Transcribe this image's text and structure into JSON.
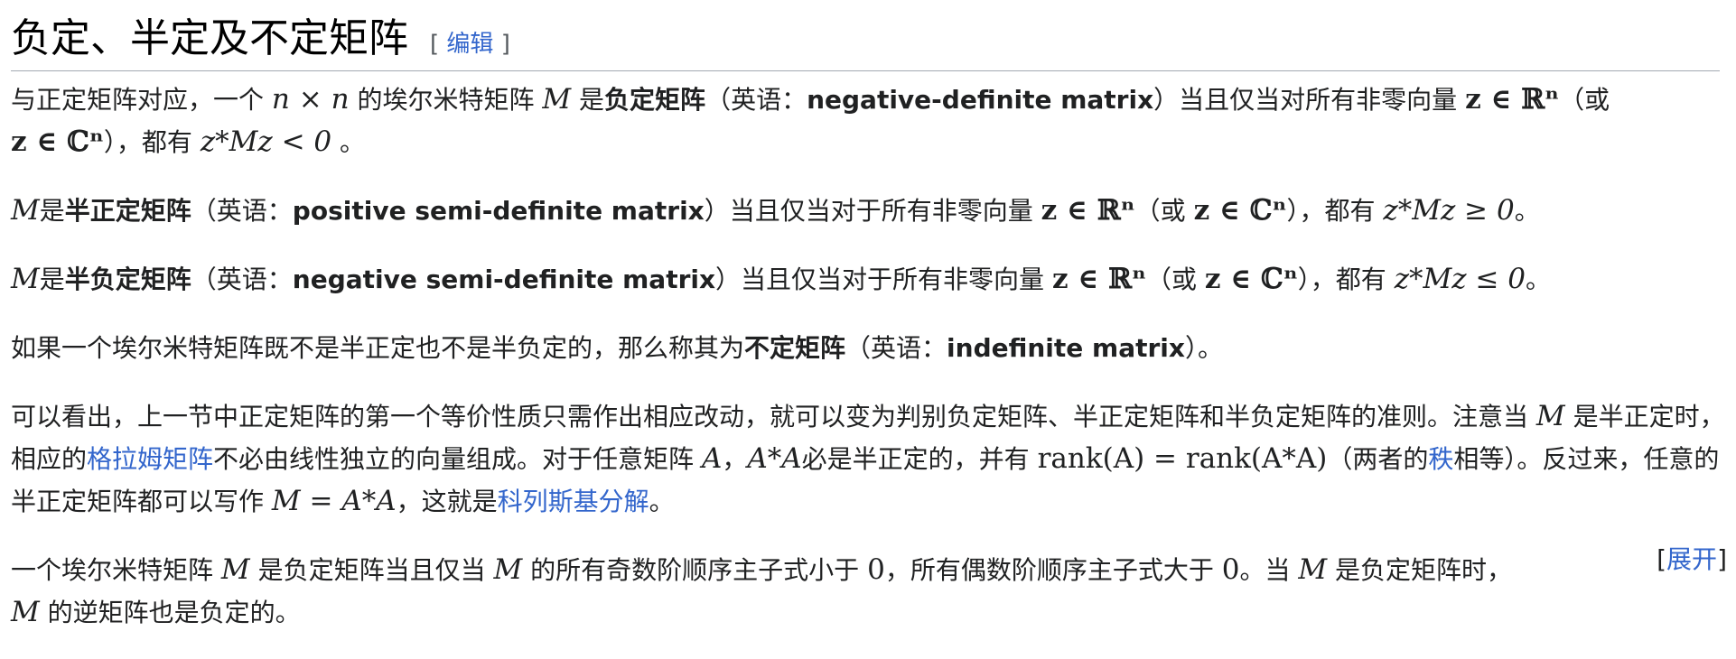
{
  "heading": {
    "title": "负定、半定及不定矩阵",
    "edit_open": "[",
    "edit_label": "编辑",
    "edit_close": "]"
  },
  "p1": {
    "t1": "与正定矩阵对应，一个",
    "m_nxn": "n × n",
    "t2": "的埃尔米特矩阵",
    "m_M": "M",
    "t3": "是",
    "b1": "负定矩阵",
    "t4": "（英语：",
    "b2": "negative-definite matrix",
    "t5": "）当且仅当对所有非零向量",
    "m_zR": "z ∈ ℝⁿ",
    "t6": "（或",
    "m_zC": "z ∈ ℂⁿ",
    "t7": "），都有",
    "m_cond": "z*Mz < 0",
    "t8": "。"
  },
  "p2": {
    "m_M": "M",
    "t1": "是",
    "b1": "半正定矩阵",
    "t2": "（英语：",
    "b2": "positive semi-definite matrix",
    "t3": "）当且仅当对于所有非零向量",
    "m_zR": "z ∈ ℝⁿ",
    "t4": "（或",
    "m_zC": "z ∈ ℂⁿ",
    "t5": "），都有",
    "m_cond": "z*Mz ≥ 0",
    "t6": "。"
  },
  "p3": {
    "m_M": "M",
    "t1": "是",
    "b1": "半负定矩阵",
    "t2": "（英语：",
    "b2": "negative semi-definite matrix",
    "t3": "）当且仅当对于所有非零向量",
    "m_zR": "z ∈ ℝⁿ",
    "t4": "（或",
    "m_zC": "z ∈ ℂⁿ",
    "t5": "），都有",
    "m_cond": "z*Mz ≤ 0",
    "t6": "。"
  },
  "p4": {
    "t1": "如果一个埃尔米特矩阵既不是半正定也不是半负定的，那么称其为",
    "b1": "不定矩阵",
    "t2": "（英语：",
    "b2": "indefinite matrix",
    "t3": "）。"
  },
  "p5": {
    "t1": "可以看出，上一节中正定矩阵的第一个等价性质只需作出相应改动，就可以变为判别负定矩阵、半正定矩阵和半负定矩阵的准则。注意当",
    "m_M": "M",
    "t2": "是半正定时，相应的",
    "link1": "格拉姆矩阵",
    "t3": "不必由线性独立的向量组成。对于任意矩阵",
    "m_A": "A",
    "t4": "，",
    "m_AA": "A*A",
    "t5": "必是半正定的，并有",
    "m_rank": "rank(A) = rank(A*A)",
    "t6": "（两者的",
    "link2": "秩",
    "t7": "相等）。反过来，任意的半正定矩阵都可以写作",
    "m_MAA": "M = A*A",
    "t8": "，这就是",
    "link3": "科列斯基分解",
    "t9": "。"
  },
  "p6": {
    "t1": "一个埃尔米特矩阵",
    "m_M1": "M",
    "t2": "是负定矩阵当且仅当",
    "m_M2": "M",
    "t3": "的所有奇数阶顺序主子式小于",
    "m_0a": "0",
    "t4": "，所有偶数阶顺序主子式大于",
    "m_0b": "0",
    "t5": "。当",
    "m_M3": "M",
    "t6": "是负定矩阵时，",
    "m_M4": "M",
    "t7": "的逆矩阵也是负定的。",
    "expand_open": "[",
    "expand_label": "展开",
    "expand_close": "]"
  }
}
